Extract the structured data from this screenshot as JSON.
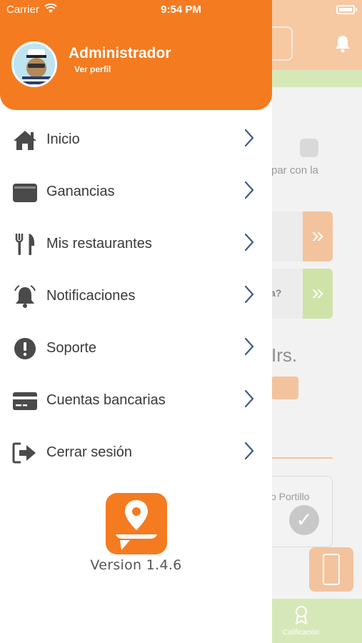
{
  "status_bar": {
    "carrier": "Carrier",
    "time": "9:54 PM"
  },
  "drawer": {
    "user_name": "Administrador",
    "profile_link": "Ver perfil",
    "menu_items": [
      {
        "label": "Inicio",
        "icon": "home-icon"
      },
      {
        "label": "Ganancias",
        "icon": "wallet-icon"
      },
      {
        "label": "Mis restaurantes",
        "icon": "fork-knife-icon"
      },
      {
        "label": "Notificaciones",
        "icon": "bell-icon"
      },
      {
        "label": "Soporte",
        "icon": "exclamation-icon"
      },
      {
        "label": "Cuentas bancarias",
        "icon": "credit-card-icon"
      },
      {
        "label": "Cerrar sesión",
        "icon": "logout-icon"
      }
    ],
    "version": "Version 1.4.6"
  },
  "background": {
    "text_partial_1": "par con la",
    "text_partial_2": "a?",
    "text_hrs": "Irs.",
    "text_portillo": "o Portillo",
    "tab_label": "Calificación"
  },
  "colors": {
    "primary_orange": "#f47b20",
    "text_dark": "#3a3a3a",
    "icon_gray": "#4a4a4a",
    "chevron_blue": "#3d5a8a"
  }
}
